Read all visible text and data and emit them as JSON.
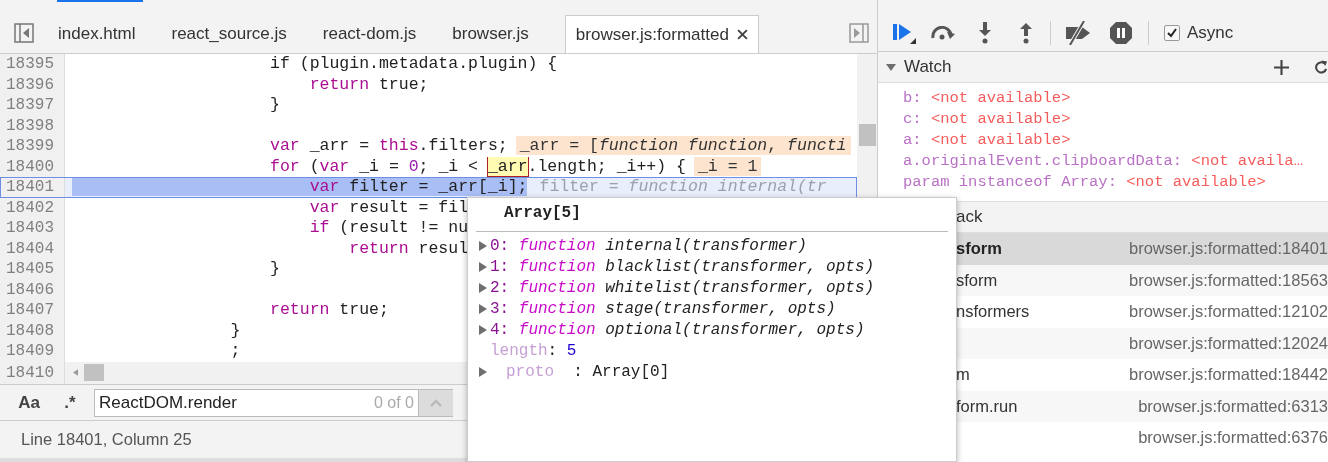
{
  "editor": {
    "tabs": [
      {
        "label": "index.html",
        "selected": false,
        "closable": false
      },
      {
        "label": "react_source.js",
        "selected": false,
        "closable": false
      },
      {
        "label": "react-dom.js",
        "selected": false,
        "closable": false
      },
      {
        "label": "browser.js",
        "selected": false,
        "closable": false
      },
      {
        "label": "browser.js:formatted",
        "selected": true,
        "closable": true
      }
    ],
    "lines": [
      {
        "number": "18395",
        "current": false,
        "tokens": [
          {
            "text": "                    if (plugin.metadata.plugin) {",
            "kind": "plain"
          }
        ]
      },
      {
        "number": "18396",
        "current": false,
        "tokens": [
          {
            "text": "                        return",
            "kind": "keyword"
          },
          {
            "text": " true;",
            "kind": "plain"
          }
        ]
      },
      {
        "number": "18397",
        "current": false,
        "tokens": [
          {
            "text": "                    }",
            "kind": "plain"
          }
        ]
      },
      {
        "number": "18398",
        "current": false
      },
      {
        "number": "18399",
        "current": false,
        "tokens": [
          {
            "text": "                    var",
            "kind": "keyword"
          },
          {
            "text": " _arr = ",
            "kind": "plain"
          },
          {
            "text": "this",
            "kind": "keyword"
          },
          {
            "text": ".filters;",
            "kind": "plain"
          },
          {
            "text": "_arr = [*function* *function*, *functi*",
            "kind": "inline"
          }
        ]
      },
      {
        "number": "18400",
        "current": false,
        "tokens": [
          {
            "text": "                    for",
            "kind": "keyword"
          },
          {
            "text": " (",
            "kind": "plain"
          },
          {
            "text": "var",
            "kind": "keyword"
          },
          {
            "text": " _i = ",
            "kind": "plain"
          },
          {
            "text": "0",
            "kind": "number"
          },
          {
            "text": "; _i < ",
            "kind": "plain"
          },
          {
            "text": "_arr",
            "kind": "hover"
          },
          {
            "text": ".length; _i++) {",
            "kind": "plain"
          },
          {
            "text": "_i = 1",
            "kind": "inline"
          }
        ]
      },
      {
        "number": "18401",
        "current": true,
        "tokens": [
          {
            "text": "                        var",
            "kind": "keyword-selected"
          },
          {
            "text": " filter = _arr[_i];",
            "kind": "plain-selected"
          },
          {
            "text": "filter = *function internal(tr*",
            "kind": "dim"
          }
        ]
      },
      {
        "number": "18402",
        "current": false,
        "tokens": [
          {
            "text": "                        var",
            "kind": "keyword"
          },
          {
            "text": " result = fil",
            "kind": "plain"
          }
        ]
      },
      {
        "number": "18403",
        "current": false,
        "tokens": [
          {
            "text": "                        if",
            "kind": "keyword"
          },
          {
            "text": " (result != nu",
            "kind": "plain"
          }
        ]
      },
      {
        "number": "18404",
        "current": false,
        "tokens": [
          {
            "text": "                            return",
            "kind": "keyword"
          },
          {
            "text": " resul",
            "kind": "plain"
          }
        ]
      },
      {
        "number": "18405",
        "current": false,
        "tokens": [
          {
            "text": "                    }",
            "kind": "plain"
          }
        ]
      },
      {
        "number": "18406",
        "current": false
      },
      {
        "number": "18407",
        "current": false,
        "tokens": [
          {
            "text": "                    return",
            "kind": "keyword"
          },
          {
            "text": " true;",
            "kind": "plain"
          }
        ]
      },
      {
        "number": "18408",
        "current": false,
        "tokens": [
          {
            "text": "                }",
            "kind": "plain"
          }
        ]
      },
      {
        "number": "18409",
        "current": false,
        "tokens": [
          {
            "text": "                ;",
            "kind": "plain"
          }
        ]
      }
    ],
    "last_line_number": "18410"
  },
  "search": {
    "case_label": "Aa",
    "regex_label": ".*",
    "value": "ReactDOM.render",
    "count": "0 of 0"
  },
  "status_bar": "Line 18401, Column 25",
  "debugger": {
    "async": {
      "label": "Async",
      "checked": true
    },
    "watch": {
      "title": "Watch",
      "expanded": true,
      "items": [
        {
          "expression": "b:",
          "value": "<not available>"
        },
        {
          "expression": "c:",
          "value": "<not available>"
        },
        {
          "expression": "a:",
          "value": "<not available>"
        },
        {
          "expression": "a.originalEvent.clipboardData:",
          "value": "<not availa…"
        },
        {
          "expression": "param instanceof Array:",
          "value": "<not available>"
        }
      ]
    },
    "call_stack": {
      "title": "ack",
      "frames": [
        {
          "name": "sform",
          "location": "browser.js:formatted:18401",
          "selected": true
        },
        {
          "name": "sform",
          "location": "browser.js:formatted:18563",
          "selected": false
        },
        {
          "name": "nsformers",
          "location": "browser.js:formatted:12102",
          "selected": false
        },
        {
          "location": "browser.js:formatted:12024",
          "selected": false
        },
        {
          "name": "m",
          "location": "browser.js:formatted:18442",
          "selected": false
        },
        {
          "name": "form.run",
          "location": "browser.js:formatted:6313",
          "selected": false
        },
        {
          "location": "browser.js:formatted:6376",
          "selected": false
        }
      ]
    }
  },
  "popover": {
    "title": "Array[5]",
    "entries": [
      {
        "key": "0:",
        "kind": "function",
        "keyword": "function",
        "value": "internal(transformer)"
      },
      {
        "key": "1:",
        "kind": "function",
        "keyword": "function",
        "value": "blacklist(transformer, opts)"
      },
      {
        "key": "2:",
        "kind": "function",
        "keyword": "function",
        "value": "whitelist(transformer, opts)"
      },
      {
        "key": "3:",
        "kind": "function",
        "keyword": "function",
        "value": "stage(transformer, opts)"
      },
      {
        "key": "4:",
        "kind": "function",
        "keyword": "function",
        "value": "optional(transformer, opts)"
      },
      {
        "key": "length",
        "kind": "number",
        "separator": ":",
        "value": "5"
      },
      {
        "key": "proto",
        "kind": "object",
        "separator": ":",
        "value": "Array[0]"
      }
    ]
  }
}
